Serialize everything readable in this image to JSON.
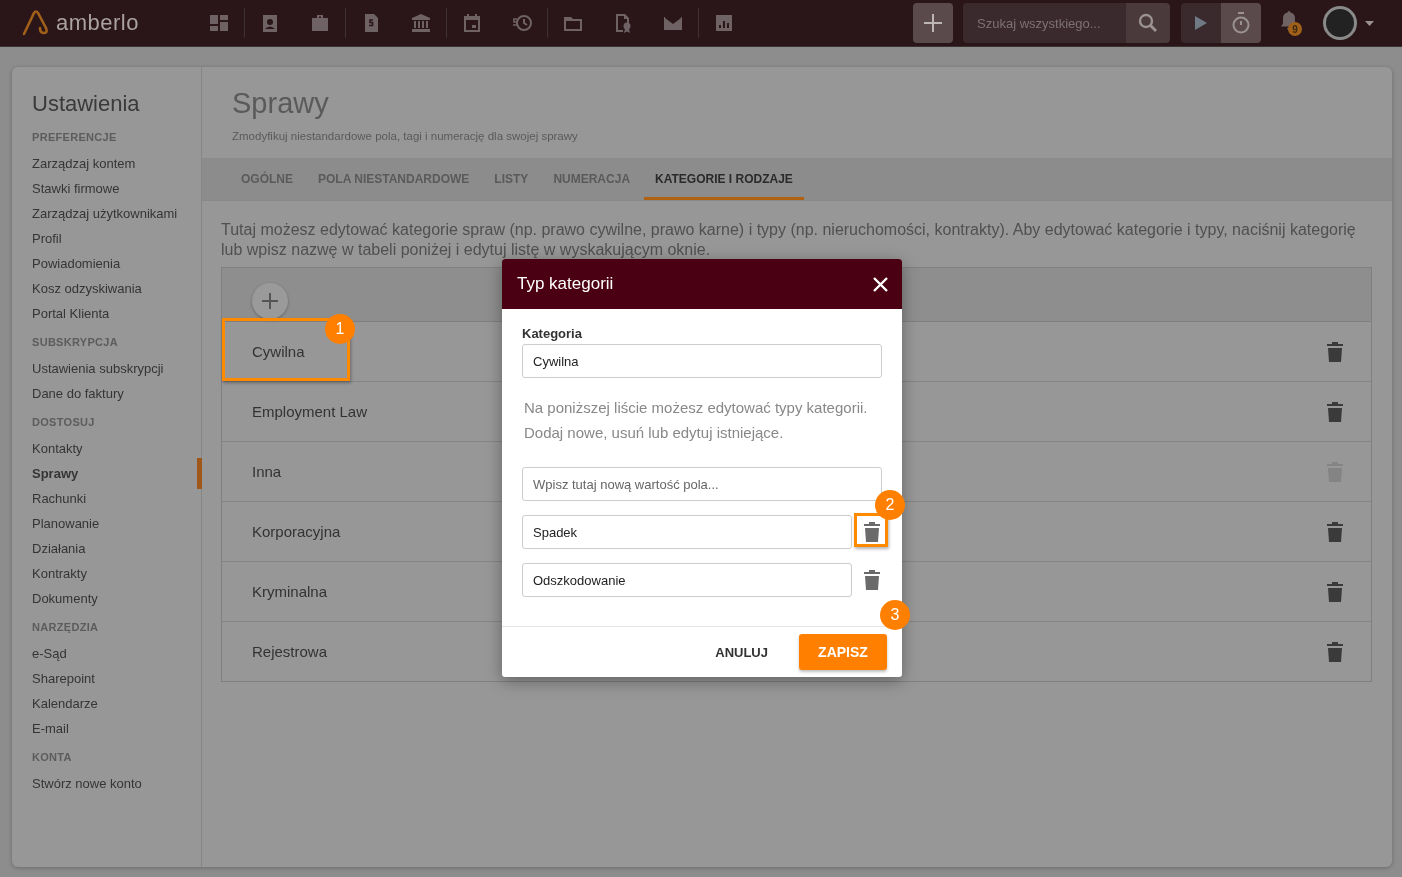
{
  "app": {
    "logo": "amberlo"
  },
  "search": {
    "placeholder": "Szukaj wszystkiego..."
  },
  "notifications": {
    "count": "9"
  },
  "sidebar": {
    "title": "Ustawienia",
    "sections": [
      {
        "heading": "PREFERENCJE",
        "items": [
          {
            "label": "Zarządzaj kontem",
            "selected": false
          },
          {
            "label": "Stawki firmowe",
            "selected": false
          },
          {
            "label": "Zarządzaj użytkownikami",
            "selected": false
          },
          {
            "label": "Profil",
            "selected": false
          },
          {
            "label": "Powiadomienia",
            "selected": false
          },
          {
            "label": "Kosz odzyskiwania",
            "selected": false
          },
          {
            "label": "Portal Klienta",
            "selected": false
          }
        ]
      },
      {
        "heading": "SUBSKRYPCJA",
        "items": [
          {
            "label": "Ustawienia subskrypcji",
            "selected": false
          },
          {
            "label": "Dane do faktury",
            "selected": false
          }
        ]
      },
      {
        "heading": "DOSTOSUJ",
        "items": [
          {
            "label": "Kontakty",
            "selected": false
          },
          {
            "label": "Sprawy",
            "selected": true
          },
          {
            "label": "Rachunki",
            "selected": false
          },
          {
            "label": "Planowanie",
            "selected": false
          },
          {
            "label": "Działania",
            "selected": false
          },
          {
            "label": "Kontrakty",
            "selected": false
          },
          {
            "label": "Dokumenty",
            "selected": false
          }
        ]
      },
      {
        "heading": "NARZĘDZIA",
        "items": [
          {
            "label": "e-Sąd",
            "selected": false
          },
          {
            "label": "Sharepoint",
            "selected": false
          },
          {
            "label": "Kalendarze",
            "selected": false
          },
          {
            "label": "E-mail",
            "selected": false
          }
        ]
      },
      {
        "heading": "KONTA",
        "items": [
          {
            "label": "Stwórz nowe konto",
            "selected": false
          }
        ]
      }
    ]
  },
  "page": {
    "title": "Sprawy",
    "subtitle": "Zmodyfikuj niestandardowe pola, tagi i numerację dla swojej sprawy"
  },
  "tabs": [
    {
      "label": "OGÓLNE",
      "selected": false
    },
    {
      "label": "POLA NIESTANDARDOWE",
      "selected": false
    },
    {
      "label": "LISTY",
      "selected": false
    },
    {
      "label": "NUMERACJA",
      "selected": false
    },
    {
      "label": "KATEGORIE I RODZAJE",
      "selected": true
    }
  ],
  "description": "Tutaj możesz edytować kategorie spraw (np. prawo cywilne, prawo karne) i typy (np. nieruchomości, kontrakty). Aby edytować kategorie i typy, naciśnij kategorię lub wpisz nazwę w tabeli poniżej i edytuj listę w wyskakującym oknie.",
  "table": {
    "rows": [
      {
        "name": "Cywilna",
        "delete_disabled": false
      },
      {
        "name": "Employment Law",
        "delete_disabled": false
      },
      {
        "name": "Inna",
        "delete_disabled": true
      },
      {
        "name": "Korporacyjna",
        "delete_disabled": false
      },
      {
        "name": "Kryminalna",
        "delete_disabled": false
      },
      {
        "name": "Rejestrowa",
        "delete_disabled": false
      }
    ]
  },
  "modal": {
    "title": "Typ kategorii",
    "category_label": "Kategoria",
    "category_value": "Cywilna",
    "hint": "Na poniższej liście możesz edytować typy kategorii. Dodaj nowe, usuń lub edytuj istniejące.",
    "new_value_placeholder": "Wpisz tutaj nową wartość pola...",
    "types": [
      {
        "value": "Spadek"
      },
      {
        "value": "Odszkodowanie"
      }
    ],
    "cancel": "ANULUJ",
    "save": "ZAPISZ"
  },
  "annotations": [
    {
      "label": "1",
      "kind": "framed"
    },
    {
      "label": "2",
      "kind": "framed"
    },
    {
      "label": "3",
      "kind": "badge"
    }
  ]
}
